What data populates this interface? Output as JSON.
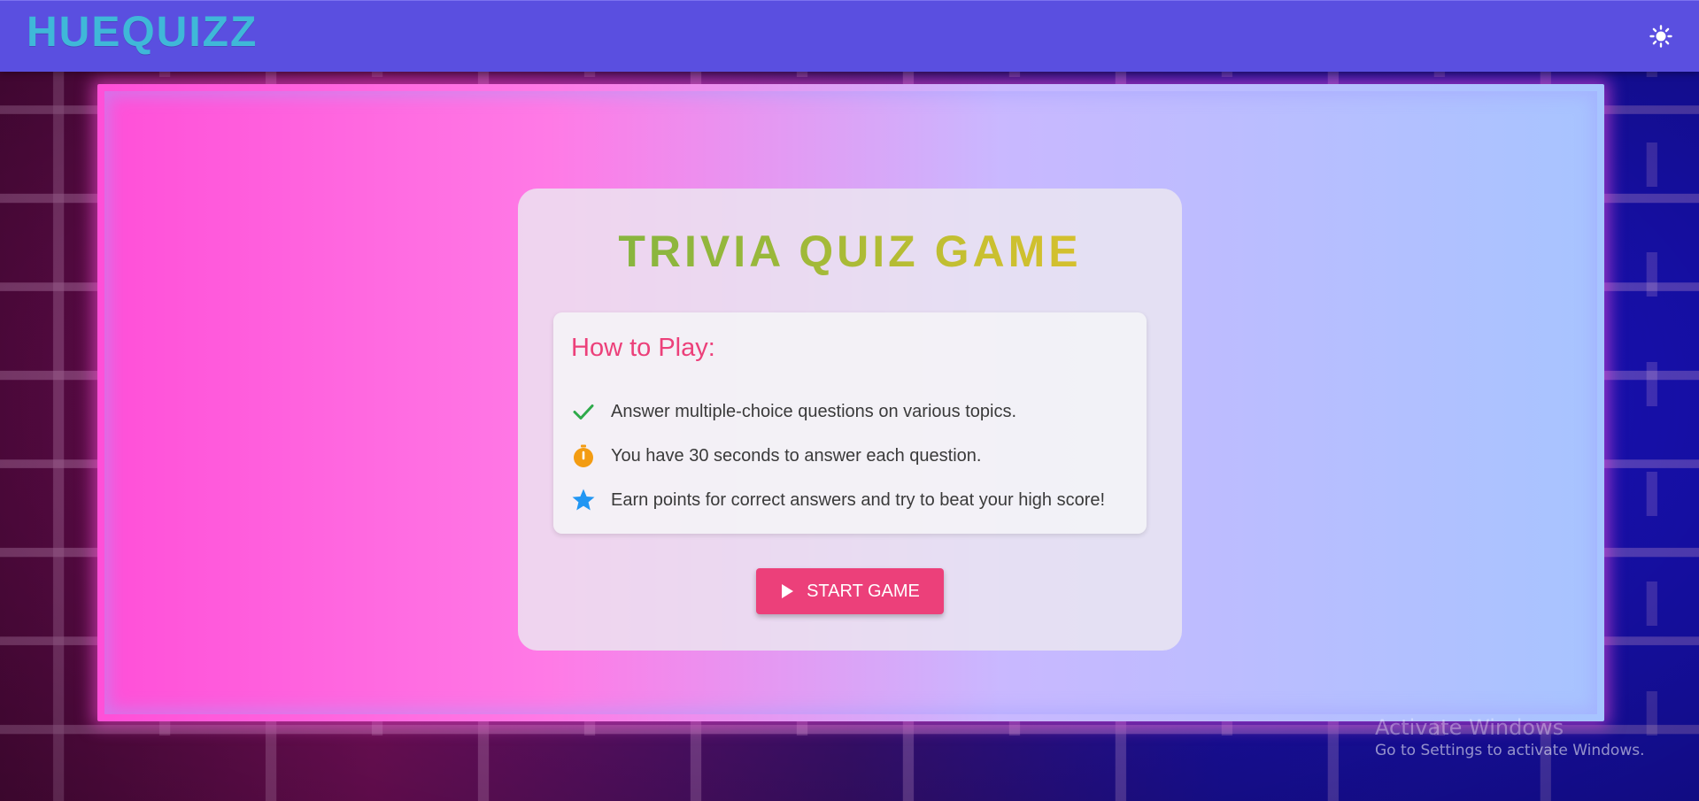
{
  "header": {
    "logo": "HUEQUIZZ",
    "theme_toggle_icon": "sun-icon"
  },
  "card": {
    "title": "TRIVIA QUIZ GAME",
    "howto": {
      "title": "How to Play:",
      "rules": [
        {
          "icon": "check-icon",
          "text": "Answer multiple-choice questions on various topics."
        },
        {
          "icon": "timer-icon",
          "text": "You have 30 seconds to answer each question."
        },
        {
          "icon": "star-icon",
          "text": "Earn points for correct answers and try to beat your high score!"
        }
      ]
    },
    "start_button": {
      "label": "START GAME",
      "icon": "play-icon"
    }
  },
  "watermark": {
    "title": "Activate Windows",
    "subtitle": "Go to Settings to activate Windows."
  },
  "colors": {
    "header_bg": "#5a4fe0",
    "logo": "#3fb8d8",
    "accent_pink": "#ec407a",
    "check_green": "#2eaa4a",
    "timer_orange": "#f39c12",
    "star_blue": "#2196f3"
  }
}
